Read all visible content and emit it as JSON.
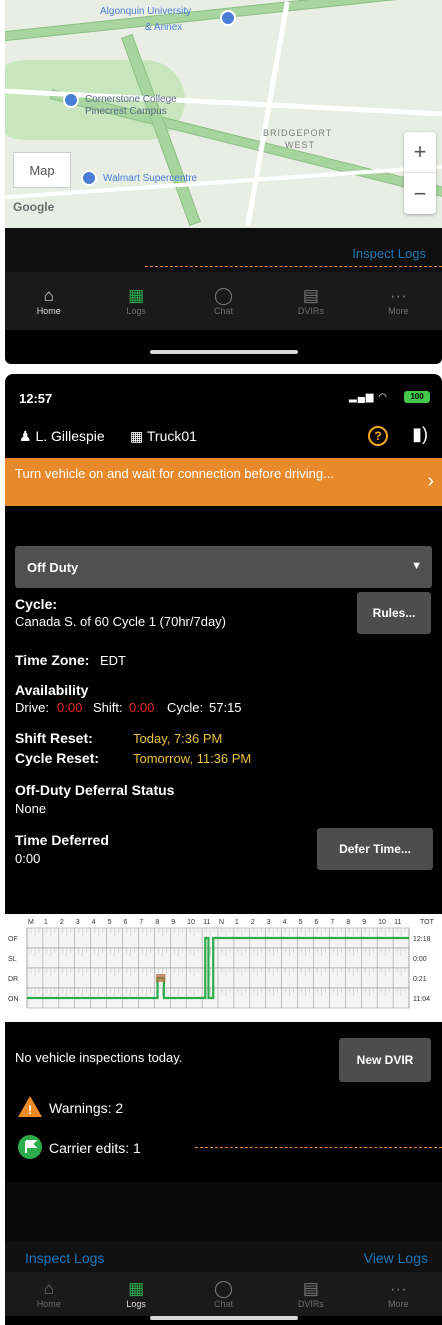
{
  "map": {
    "labels": {
      "university": "Algonquin University",
      "campus_line2": "& Annex",
      "college": "Cornerstone College",
      "college_line2": "Pinecrest Campus",
      "bridgeport": "BRIDGEPORT",
      "bridgeport_line2": "WEST",
      "superstore": "Walmart Supercentre",
      "map_button": "Map",
      "google": "Google"
    },
    "zoom_in": "+",
    "zoom_out": "−"
  },
  "top": {
    "inspect_logs": "Inspect Logs",
    "tabs": [
      {
        "label": "Home",
        "icon": "home-icon",
        "glyph": "⌂"
      },
      {
        "label": "Logs",
        "icon": "logs-icon",
        "glyph": "▦"
      },
      {
        "label": "Chat",
        "icon": "chat-icon",
        "glyph": "◯"
      },
      {
        "label": "DVIRs",
        "icon": "dvir-icon",
        "glyph": "▤"
      },
      {
        "label": "More",
        "icon": "more-icon",
        "glyph": "···"
      }
    ]
  },
  "bottom": {
    "status": {
      "time": "12:57",
      "battery": "100"
    },
    "driver": {
      "name": "L. Gillespie",
      "truck": "Truck01"
    },
    "banner": "Turn vehicle on and wait for connection before driving...",
    "duty_status": "Off Duty",
    "cycle_label": "Cycle:",
    "cycle_value": "Canada S. of 60 Cycle 1 (70hr/7day)",
    "rules_button": "Rules...",
    "time_zone_label": "Time Zone:",
    "time_zone_value": "EDT",
    "availability_label": "Availability",
    "drive_label": "Drive:",
    "drive_value": "0:00",
    "shift_label": "Shift:",
    "shift_value": "0:00",
    "cycle_avail_label": "Cycle:",
    "cycle_avail_value": "57:15",
    "shift_reset_label": "Shift Reset:",
    "shift_reset_value": "Today, 7:36 PM",
    "cycle_reset_label": "Cycle Reset:",
    "cycle_reset_value": "Tomorrow, 11:36 PM",
    "deferral_label": "Off-Duty Deferral Status",
    "deferral_value": "None",
    "time_deferred_label": "Time Deferred",
    "time_deferred_value": "0:00",
    "defer_button": "Defer Time...",
    "graph": {
      "hours": [
        "M",
        "1",
        "2",
        "3",
        "4",
        "5",
        "6",
        "7",
        "8",
        "9",
        "10",
        "11",
        "N",
        "1",
        "2",
        "3",
        "4",
        "5",
        "6",
        "7",
        "8",
        "9",
        "10",
        "11"
      ],
      "tot_label": "TOT",
      "rows": [
        "OF",
        "SL",
        "DR",
        "ON"
      ],
      "totals": [
        "12:18",
        "0:00",
        "0:21",
        "11:04"
      ]
    },
    "no_inspections": "No vehicle inspections today.",
    "new_dvir_button": "New DVIR",
    "warnings": "Warnings: 2",
    "carrier_edits": "Carrier edits: 1",
    "inspect_logs": "Inspect Logs",
    "view_logs": "View Logs",
    "tabs": [
      {
        "label": "Home",
        "glyph": "⌂"
      },
      {
        "label": "Logs",
        "glyph": "▦"
      },
      {
        "label": "Chat",
        "glyph": "◯"
      },
      {
        "label": "DVIRs",
        "glyph": "▤"
      },
      {
        "label": "More",
        "glyph": "···"
      }
    ]
  },
  "colors": {
    "accent_orange": "#e8892b",
    "link_blue": "#1b78b8",
    "status_red": "#e5282a",
    "reset_yellow": "#e8c239",
    "graph_green": "#2eab4a"
  }
}
